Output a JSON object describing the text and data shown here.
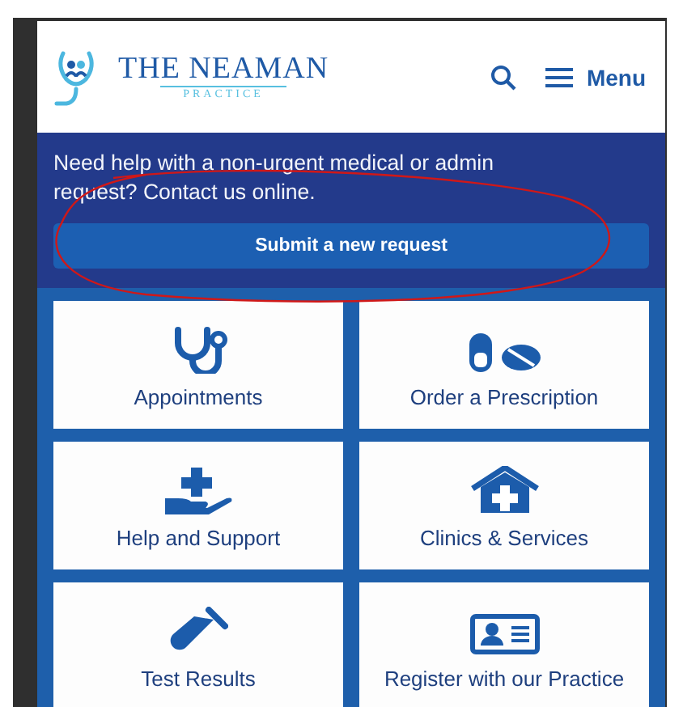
{
  "header": {
    "logo": {
      "title": "THE NEAMAN",
      "subtitle": "PRACTICE"
    },
    "menu_label": "Menu"
  },
  "banner": {
    "message": "Need help with a non-urgent medical or admin request? Contact us online.",
    "button": "Submit a new request"
  },
  "tiles": [
    {
      "label": "Appointments",
      "kind": "stethoscope"
    },
    {
      "label": "Order a Prescription",
      "kind": "pills"
    },
    {
      "label": "Help and Support",
      "kind": "care"
    },
    {
      "label": "Clinics & Services",
      "kind": "clinic"
    },
    {
      "label": "Test Results",
      "kind": "tube"
    },
    {
      "label": "Register with our Practice",
      "kind": "idcard"
    }
  ]
}
